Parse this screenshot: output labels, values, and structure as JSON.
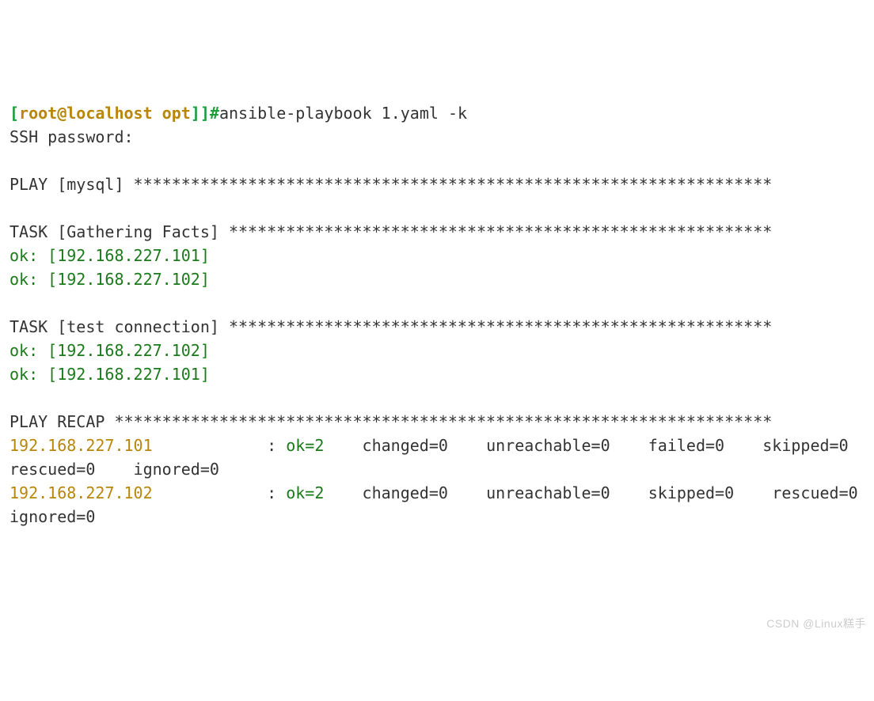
{
  "prompt": {
    "open": "[",
    "user": "root",
    "at": "@",
    "host": "localhost",
    "path": " opt",
    "close": "]",
    "suffix": "]#"
  },
  "command": "ansible-playbook 1.yaml -k",
  "ssh_prompt": "SSH password:",
  "play_header": "PLAY [mysql] *******************************************************************",
  "task1_header": "TASK [Gathering Facts] *********************************************************",
  "task1_ok1": "ok: [192.168.227.101]",
  "task1_ok2": "ok: [192.168.227.102]",
  "task2_header": "TASK [test connection] *********************************************************",
  "task2_ok1": "ok: [192.168.227.102]",
  "task2_ok2": "ok: [192.168.227.101]",
  "recap_header": "PLAY RECAP *********************************************************************",
  "recap1": {
    "host": "192.168.227.101",
    "spacer": "            : ",
    "ok": "ok=2",
    "rest": "    changed=0    unreachable=0    failed=0    skipped=0    rescued=0    ignored=0"
  },
  "recap2": {
    "host": "192.168.227.102",
    "spacer": "            : ",
    "ok": "ok=2",
    "rest": "    changed=0    unreachable=0    skipped=0    rescued=0    ignored=0"
  },
  "watermark": "CSDN @Linux糕手"
}
